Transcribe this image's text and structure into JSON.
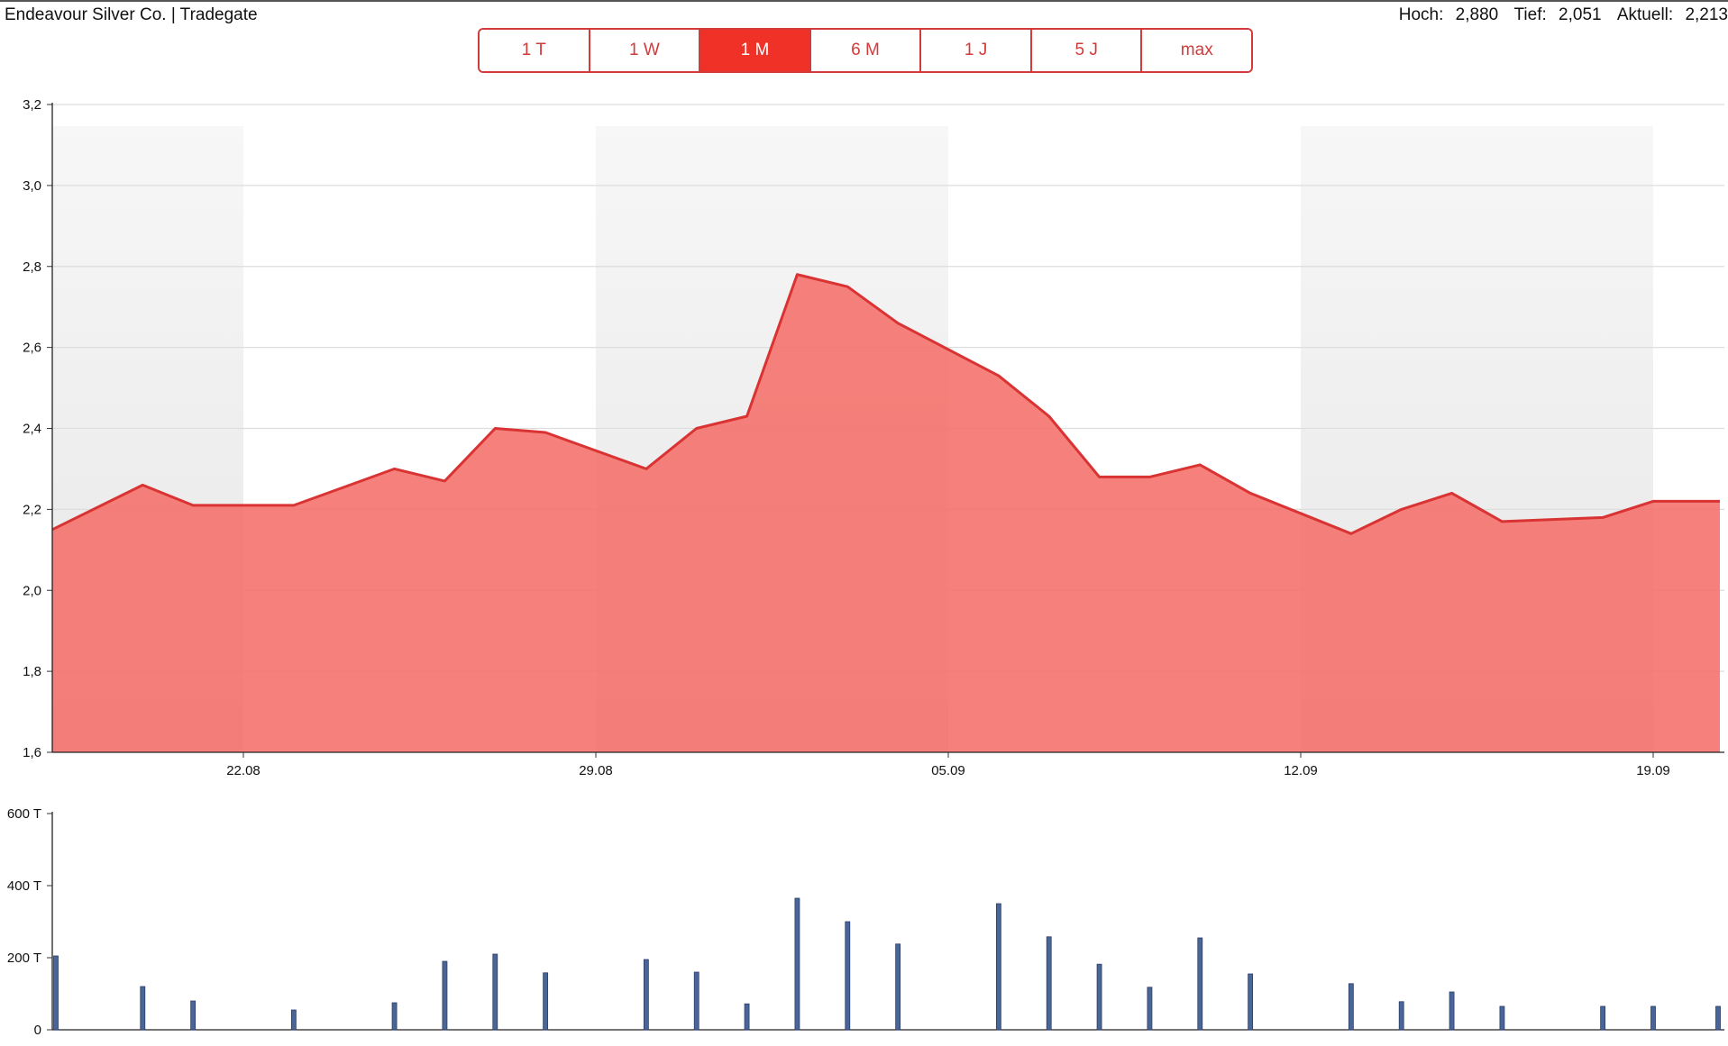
{
  "header": {
    "title": "Endeavour Silver Co. | Tradegate",
    "stats": [
      {
        "label": "Hoch:",
        "value": "2,880"
      },
      {
        "label": "Tief:",
        "value": "2,051"
      },
      {
        "label": "Aktuell:",
        "value": "2,213"
      }
    ]
  },
  "range_tabs": [
    {
      "label": "1 T",
      "active": false
    },
    {
      "label": "1 W",
      "active": false
    },
    {
      "label": "1 M",
      "active": true
    },
    {
      "label": "6 M",
      "active": false
    },
    {
      "label": "1 J",
      "active": false
    },
    {
      "label": "5 J",
      "active": false
    },
    {
      "label": "max",
      "active": false
    }
  ],
  "colors": {
    "line": "#d93333",
    "area": "#f5706a",
    "accent": "#ef3128",
    "band": "#ebebeb",
    "volume": "#4a6698",
    "grid": "#dddddd"
  },
  "chart_data": [
    {
      "type": "area",
      "x_ticks": [
        "22.08",
        "29.08",
        "05.09",
        "12.09",
        "19.09"
      ],
      "y_ticks": [
        "1,6",
        "1,8",
        "2,0",
        "2,2",
        "2,4",
        "2,6",
        "2,8",
        "3,0",
        "3,2"
      ],
      "ylim": [
        1.6,
        3.2
      ],
      "x": [
        "18.08",
        "20.08",
        "21.08",
        "23.08",
        "25.08",
        "26.08",
        "27.08",
        "28.08",
        "30.08",
        "31.08",
        "01.09",
        "02.09",
        "03.09",
        "04.09",
        "06.09",
        "07.09",
        "08.09",
        "09.09",
        "10.09",
        "11.09",
        "13.09",
        "14.09",
        "15.09",
        "16.09",
        "18.09",
        "19.09",
        "21.09"
      ],
      "values": [
        2.15,
        2.26,
        2.21,
        2.21,
        2.3,
        2.27,
        2.4,
        2.39,
        2.3,
        2.4,
        2.43,
        2.78,
        2.75,
        2.66,
        2.53,
        2.43,
        2.28,
        2.28,
        2.31,
        2.24,
        2.14,
        2.2,
        2.24,
        2.17,
        2.18,
        2.22,
        2.22
      ],
      "grid": true,
      "weekend_bands": true
    },
    {
      "type": "bar",
      "y_ticks": [
        "0",
        "200 T",
        "400 T",
        "600 T"
      ],
      "ylim": [
        0,
        600000
      ],
      "x": [
        "18.08",
        "20.08",
        "21.08",
        "23.08",
        "25.08",
        "26.08",
        "27.08",
        "28.08",
        "30.08",
        "31.08",
        "01.09",
        "02.09",
        "03.09",
        "04.09",
        "06.09",
        "07.09",
        "08.09",
        "09.09",
        "10.09",
        "11.09",
        "13.09",
        "14.09",
        "15.09",
        "16.09",
        "18.09",
        "19.09",
        "21.09"
      ],
      "values": [
        205000,
        120000,
        80000,
        55000,
        75000,
        190000,
        210000,
        158000,
        195000,
        160000,
        72000,
        365000,
        300000,
        238000,
        350000,
        258000,
        182000,
        118000,
        255000,
        155000,
        128000,
        78000,
        105000,
        65000,
        65000,
        65000,
        65000
      ]
    }
  ]
}
